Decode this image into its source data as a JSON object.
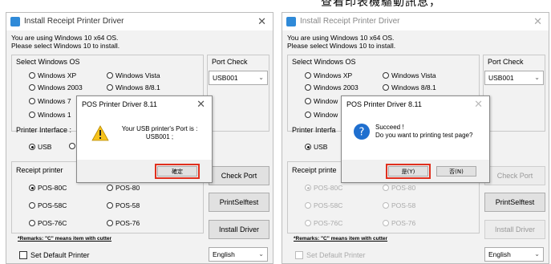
{
  "caption": "查看印表機驅動訊息，",
  "windows": [
    {
      "title": "Install Receipt Printer Driver",
      "info_line1": "You are using Windows 10 x64 OS.",
      "info_line2": "Please select Windows 10 to install.",
      "select_os_label": "Select Windows OS",
      "os_options": [
        "Windows XP",
        "Windows Vista",
        "Windows 2003",
        "Windows 8/8.1",
        "Windows 7",
        "Windows 1"
      ],
      "port_check_label": "Port Check",
      "port_value": "USB001",
      "printer_interface_label": "Printer Interface :",
      "usb_label": "USB",
      "receipt_printer_label": "Receipt printer",
      "printers": [
        "POS-80C",
        "POS-80",
        "POS-58C",
        "POS-58",
        "POS-76C",
        "POS-76"
      ],
      "check_port_btn": "Check Port",
      "print_selftest_btn": "PrintSelftest",
      "install_driver_btn": "Install Driver",
      "remarks": "*Remarks: \"C\" means item with cutter",
      "default_printer_label": "Set Default Printer",
      "language_value": "English",
      "dialog": {
        "title": "POS Printer Driver 8.11",
        "msg_line1": "Your USB printer's Port is :",
        "msg_line2": "USB001 ;",
        "ok_btn": "確定"
      }
    },
    {
      "title": "Install Receipt Printer Driver",
      "info_line1": "You are using Windows 10 x64 OS.",
      "info_line2": "Please select Windows 10 to install.",
      "select_os_label": "Select Windows OS",
      "os_options": [
        "Windows XP",
        "Windows Vista",
        "Windows 2003",
        "Windows 8/8.1",
        "Window",
        "Window"
      ],
      "port_check_label": "Port Check",
      "port_value": "USB001",
      "printer_interface_label": "Printer Interfa",
      "usb_label": "USB",
      "receipt_printer_label": "Receipt printe",
      "printers": [
        "POS-80C",
        "POS-80",
        "POS-58C",
        "POS-58",
        "POS-76C",
        "POS-76"
      ],
      "check_port_btn": "Check Port",
      "print_selftest_btn": "PrintSelftest",
      "install_driver_btn": "Install Driver",
      "remarks": "*Remarks: \"C\" means item with cutter",
      "default_printer_label": "Set Default Printer",
      "language_value": "English",
      "dialog": {
        "title": "POS Printer Driver 8.11",
        "msg_line1": "Succeed !",
        "msg_line2": "Do you want to printing test page?",
        "yes_btn": "是(Y)",
        "no_btn": "否(N)"
      }
    }
  ]
}
